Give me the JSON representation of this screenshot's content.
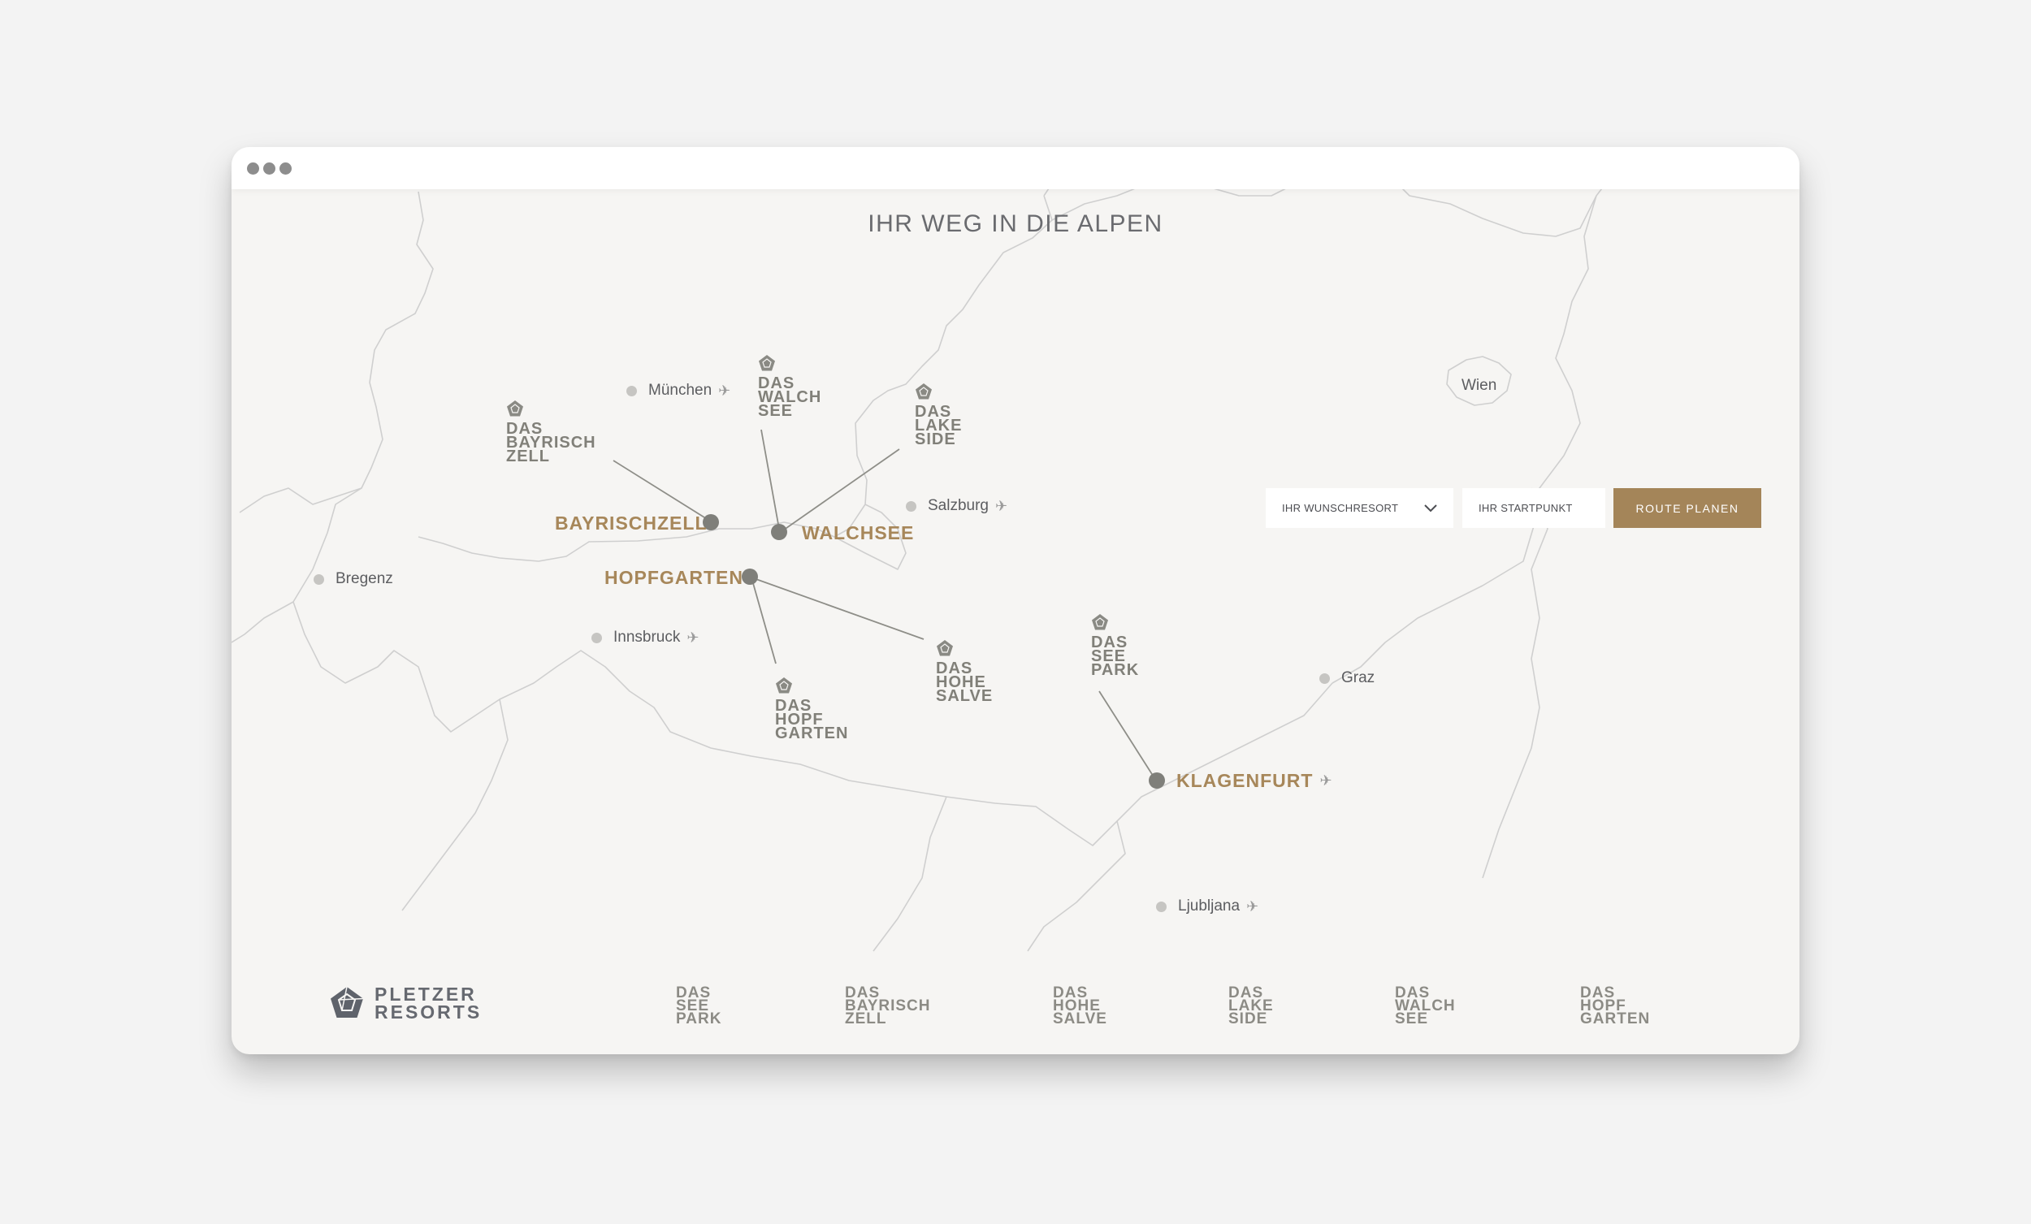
{
  "window": {
    "controls": [
      "close",
      "minimize",
      "maximize"
    ]
  },
  "map": {
    "title": "IHR WEG IN DIE ALPEN",
    "cities": [
      {
        "id": "muenchen",
        "label": "München",
        "airport": true
      },
      {
        "id": "salzburg",
        "label": "Salzburg",
        "airport": true
      },
      {
        "id": "bregenz",
        "label": "Bregenz",
        "airport": false
      },
      {
        "id": "innsbruck",
        "label": "Innsbruck",
        "airport": true
      },
      {
        "id": "graz",
        "label": "Graz",
        "airport": false
      },
      {
        "id": "ljubljana",
        "label": "Ljubljana",
        "airport": true
      },
      {
        "id": "wien",
        "label": "Wien",
        "airport": false
      }
    ],
    "locations": [
      {
        "id": "bayrischzell",
        "label": "BAYRISCHZELL"
      },
      {
        "id": "walchsee",
        "label": "WALCHSEE"
      },
      {
        "id": "hopfgarten",
        "label": "HOPFGARTEN"
      },
      {
        "id": "klagenfurt",
        "label": "KLAGENFURT",
        "airport": true
      }
    ],
    "resorts": [
      {
        "id": "das-bayrisch-zell",
        "lines": [
          "DAS",
          "BAYRISCH",
          "ZELL"
        ]
      },
      {
        "id": "das-walch-see",
        "lines": [
          "DAS",
          "WALCH",
          "SEE"
        ]
      },
      {
        "id": "das-lake-side",
        "lines": [
          "DAS",
          "LAKE",
          "SIDE"
        ]
      },
      {
        "id": "das-hohe-salve",
        "lines": [
          "DAS",
          "HOHE",
          "SALVE"
        ]
      },
      {
        "id": "das-hopf-garten",
        "lines": [
          "DAS",
          "HOPF",
          "GARTEN"
        ]
      },
      {
        "id": "das-see-park",
        "lines": [
          "DAS",
          "SEE",
          "PARK"
        ]
      }
    ]
  },
  "route_form": {
    "resort_select_label": "IHR WUNSCHRESORT",
    "start_placeholder": "IHR STARTPUNKT",
    "submit_label": "ROUTE PLANEN"
  },
  "footer": {
    "brand_line1": "PLETZER",
    "brand_line2": "RESORTS",
    "links": [
      {
        "id": "see-park",
        "lines": [
          "DAS",
          "SEE",
          "PARK"
        ]
      },
      {
        "id": "bayrisch-zell",
        "lines": [
          "DAS",
          "BAYRISCH",
          "ZELL"
        ]
      },
      {
        "id": "hohe-salve",
        "lines": [
          "DAS",
          "HOHE",
          "SALVE"
        ]
      },
      {
        "id": "lake-side",
        "lines": [
          "DAS",
          "LAKE",
          "SIDE"
        ]
      },
      {
        "id": "walch-see",
        "lines": [
          "DAS",
          "WALCH",
          "SEE"
        ]
      },
      {
        "id": "hopf-garten",
        "lines": [
          "DAS",
          "HOPF",
          "GARTEN"
        ]
      }
    ]
  },
  "colors": {
    "accent_gold": "#a48559",
    "marker_grey": "#7f7f7a",
    "map_background": "#f6f5f3",
    "border_line": "#c9c9c9"
  },
  "icons": {
    "airport": "plane-icon",
    "resort": "pentagon-logo-icon",
    "dropdown": "chevron-down-icon"
  }
}
